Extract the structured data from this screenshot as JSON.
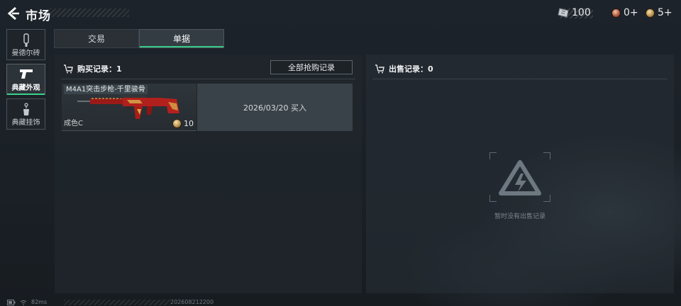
{
  "header": {
    "title": "市场",
    "currencies": [
      {
        "icon": "ticket-icon",
        "value": "100"
      },
      {
        "icon": "red-coin-icon",
        "value": "0+"
      },
      {
        "icon": "gold-coin-icon",
        "value": "5+"
      }
    ]
  },
  "sidebar": {
    "items": [
      {
        "label": "曼德尔砖",
        "icon": "brick-icon",
        "active": false
      },
      {
        "label": "典藏外观",
        "icon": "pistol-icon",
        "active": true
      },
      {
        "label": "典藏挂饰",
        "icon": "charm-icon",
        "active": false
      }
    ]
  },
  "tabs": [
    {
      "label": "交易",
      "active": false
    },
    {
      "label": "单据",
      "active": true
    }
  ],
  "purchase": {
    "header": "购买记录：1",
    "all_button": "全部抢购记录",
    "records": [
      {
        "name": "M4A1突击步枪-千里骏骨",
        "quality": "成色C",
        "price": "10",
        "info": "2026/03/20 买入"
      }
    ]
  },
  "sales": {
    "header": "出售记录：0",
    "empty_text": "暂时没有出售记录"
  },
  "status_bar": {
    "ping": "82ms",
    "uid": "202608212200"
  },
  "colors": {
    "accent": "#3ad28c",
    "rifle_red": "#b0201c",
    "rifle_gold": "#d8a84a"
  }
}
